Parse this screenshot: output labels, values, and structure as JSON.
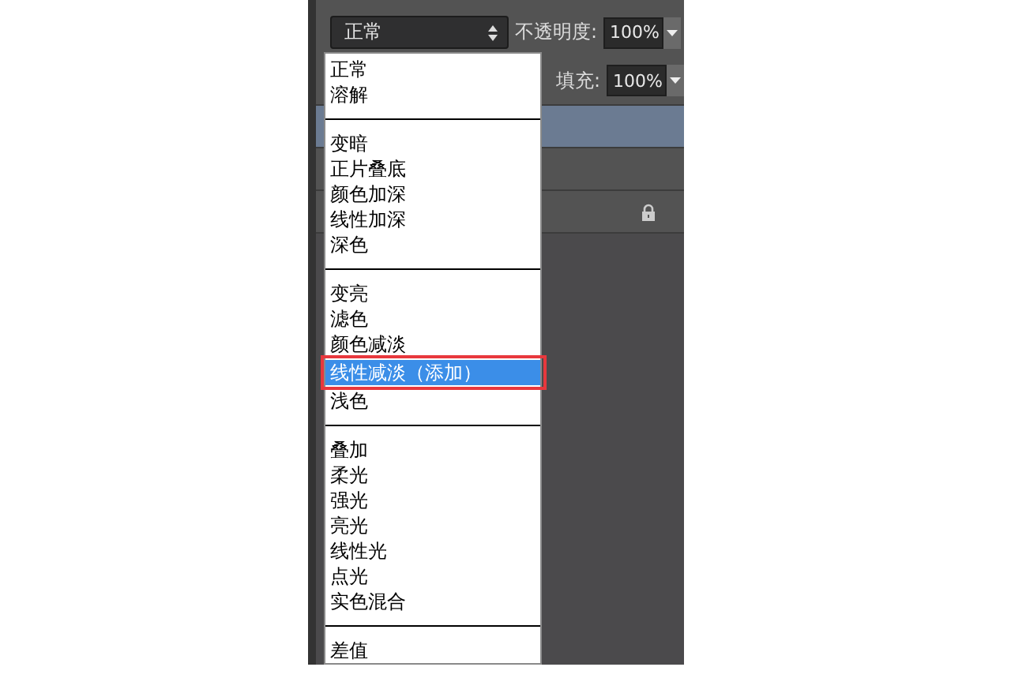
{
  "blend_mode_select": {
    "value": "正常"
  },
  "opacity": {
    "label": "不透明度:",
    "value": "100%"
  },
  "fill": {
    "label": "填充:",
    "value": "100%"
  },
  "layers": [
    {
      "selected": true,
      "locked": false
    },
    {
      "selected": false,
      "locked": false
    },
    {
      "selected": false,
      "locked": true
    }
  ],
  "blend_menu": {
    "groups": [
      {
        "items": [
          {
            "label": "正常",
            "selected": false,
            "highlighted": false
          },
          {
            "label": "溶解",
            "selected": false,
            "highlighted": false
          }
        ]
      },
      {
        "items": [
          {
            "label": "变暗",
            "selected": false,
            "highlighted": false
          },
          {
            "label": "正片叠底",
            "selected": false,
            "highlighted": false
          },
          {
            "label": "颜色加深",
            "selected": false,
            "highlighted": false
          },
          {
            "label": "线性加深",
            "selected": false,
            "highlighted": false
          },
          {
            "label": "深色",
            "selected": false,
            "highlighted": false
          }
        ]
      },
      {
        "items": [
          {
            "label": "变亮",
            "selected": false,
            "highlighted": false
          },
          {
            "label": "滤色",
            "selected": false,
            "highlighted": false
          },
          {
            "label": "颜色减淡",
            "selected": false,
            "highlighted": false
          },
          {
            "label": "线性减淡（添加）",
            "selected": true,
            "highlighted": true
          },
          {
            "label": "浅色",
            "selected": false,
            "highlighted": false
          }
        ]
      },
      {
        "items": [
          {
            "label": "叠加",
            "selected": false,
            "highlighted": false
          },
          {
            "label": "柔光",
            "selected": false,
            "highlighted": false
          },
          {
            "label": "强光",
            "selected": false,
            "highlighted": false
          },
          {
            "label": "亮光",
            "selected": false,
            "highlighted": false
          },
          {
            "label": "线性光",
            "selected": false,
            "highlighted": false
          },
          {
            "label": "点光",
            "selected": false,
            "highlighted": false
          },
          {
            "label": "实色混合",
            "selected": false,
            "highlighted": false
          }
        ]
      },
      {
        "items": [
          {
            "label": "差值",
            "selected": false,
            "highlighted": false
          }
        ]
      }
    ]
  }
}
